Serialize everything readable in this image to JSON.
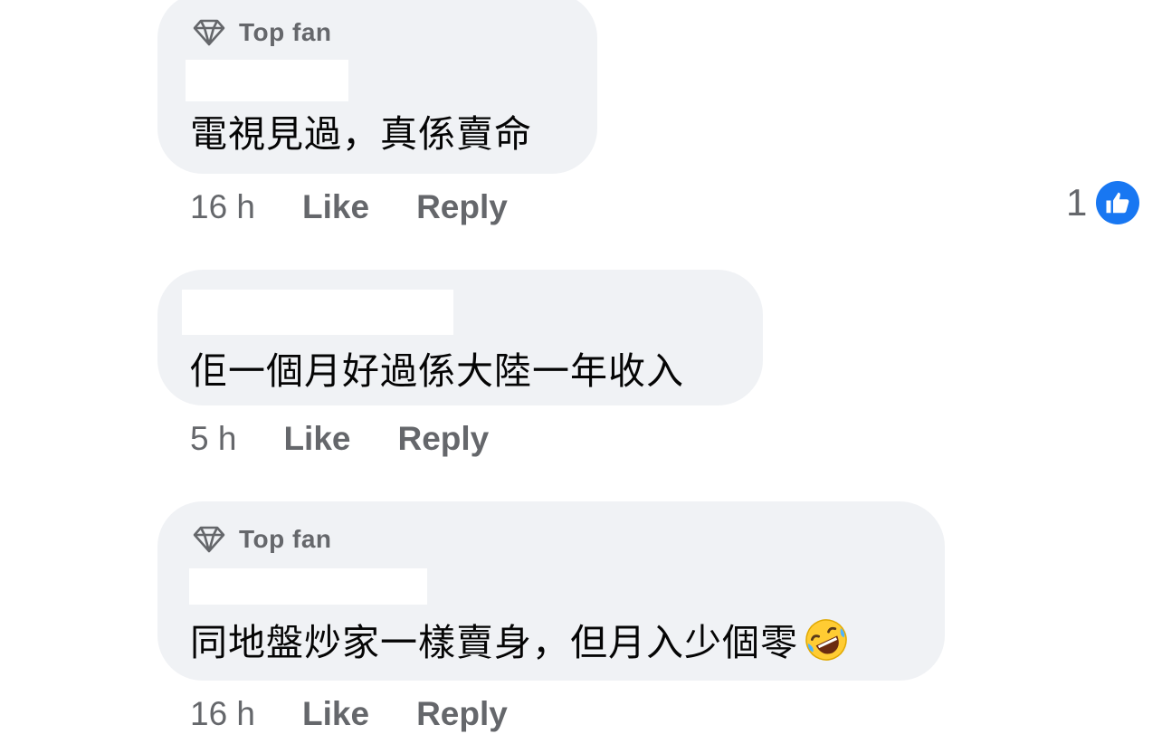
{
  "comments": [
    {
      "badge": "Top fan",
      "text": "電視見過，真係賣命",
      "time": "16 h",
      "like_label": "Like",
      "reply_label": "Reply",
      "reaction_count": "1"
    },
    {
      "text": "佢一個月好過係大陸一年收入",
      "time": "5 h",
      "like_label": "Like",
      "reply_label": "Reply"
    },
    {
      "badge": "Top fan",
      "text": "同地盤炒家一樣賣身，但月入少個零",
      "emoji": "rolling-on-floor-laughing-emoji",
      "time": "16 h",
      "like_label": "Like",
      "reply_label": "Reply"
    }
  ],
  "icons": {
    "badge": "diamond-icon",
    "reaction": "thumbs-up-icon"
  },
  "colors": {
    "bubble": "#f0f2f5",
    "meta_text": "#65676b",
    "body_text": "#050505",
    "like_blue": "#1877f2"
  }
}
